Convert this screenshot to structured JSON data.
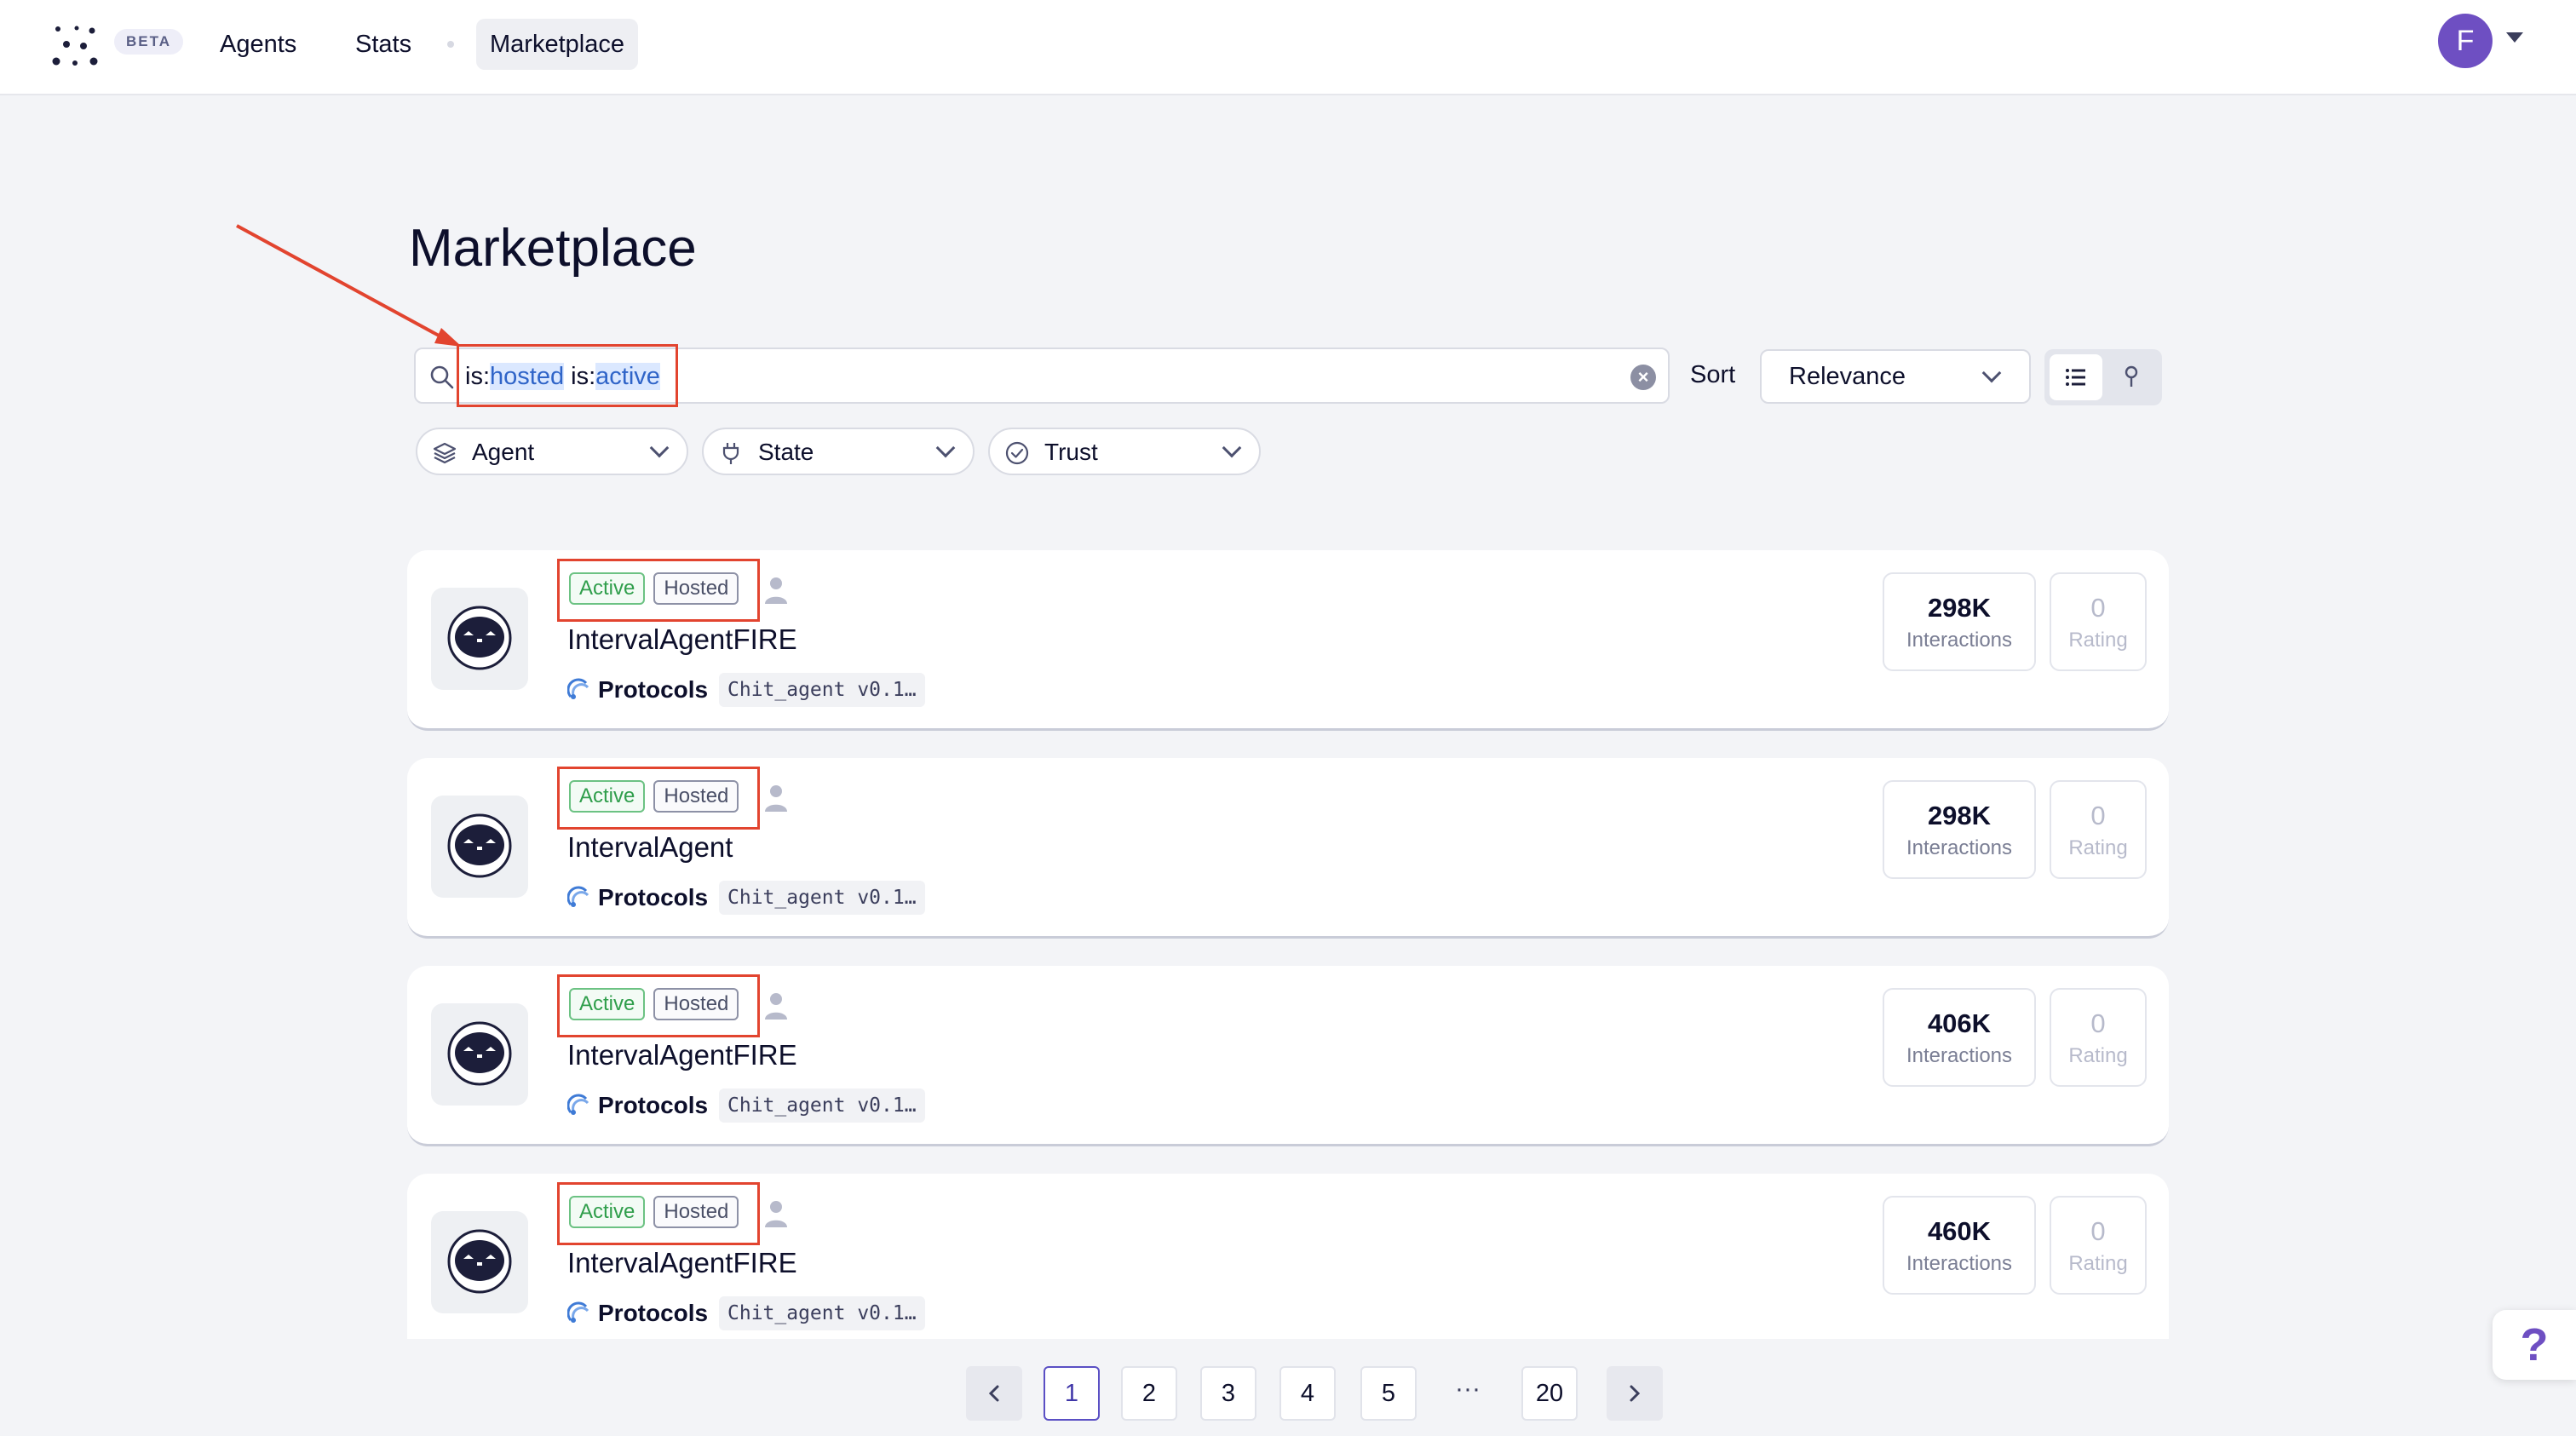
{
  "header": {
    "beta_label": "BETA",
    "nav": [
      {
        "label": "Agents"
      },
      {
        "label": "Stats"
      },
      {
        "label": "Marketplace"
      }
    ],
    "avatar_initial": "F"
  },
  "page": {
    "title": "Marketplace"
  },
  "search": {
    "query_parts": [
      {
        "text": "is:",
        "highlight": false
      },
      {
        "text": "hosted",
        "highlight": true
      },
      {
        "text": " is:",
        "highlight": false
      },
      {
        "text": "active",
        "highlight": true
      }
    ],
    "clear_icon": "close-circle-icon"
  },
  "sort": {
    "label": "Sort",
    "selected": "Relevance"
  },
  "filters": [
    {
      "label": "Agent",
      "icon": "layers-icon"
    },
    {
      "label": "State",
      "icon": "plug-icon"
    },
    {
      "label": "Trust",
      "icon": "check-circle-icon"
    }
  ],
  "agents": [
    {
      "badges": [
        "Active",
        "Hosted"
      ],
      "name": "IntervalAgentFIRE",
      "protocols_label": "Protocols",
      "protocol": "Chit_agent v0.1…",
      "interactions": "298K",
      "interactions_label": "Interactions",
      "rating": "0",
      "rating_label": "Rating"
    },
    {
      "badges": [
        "Active",
        "Hosted"
      ],
      "name": "IntervalAgent",
      "protocols_label": "Protocols",
      "protocol": "Chit_agent v0.1…",
      "interactions": "298K",
      "interactions_label": "Interactions",
      "rating": "0",
      "rating_label": "Rating"
    },
    {
      "badges": [
        "Active",
        "Hosted"
      ],
      "name": "IntervalAgentFIRE",
      "protocols_label": "Protocols",
      "protocol": "Chit_agent v0.1…",
      "interactions": "406K",
      "interactions_label": "Interactions",
      "rating": "0",
      "rating_label": "Rating"
    },
    {
      "badges": [
        "Active",
        "Hosted"
      ],
      "name": "IntervalAgentFIRE",
      "protocols_label": "Protocols",
      "protocol": "Chit_agent v0.1…",
      "interactions": "460K",
      "interactions_label": "Interactions",
      "rating": "0",
      "rating_label": "Rating"
    }
  ],
  "pagination": {
    "pages": [
      "1",
      "2",
      "3",
      "4",
      "5"
    ],
    "ellipsis": "···",
    "last": "20",
    "current": "1"
  },
  "help_label": "?",
  "colors": {
    "accent": "#6e4fc2",
    "annotation": "#e2442f",
    "active_green": "#2f9e4b"
  }
}
